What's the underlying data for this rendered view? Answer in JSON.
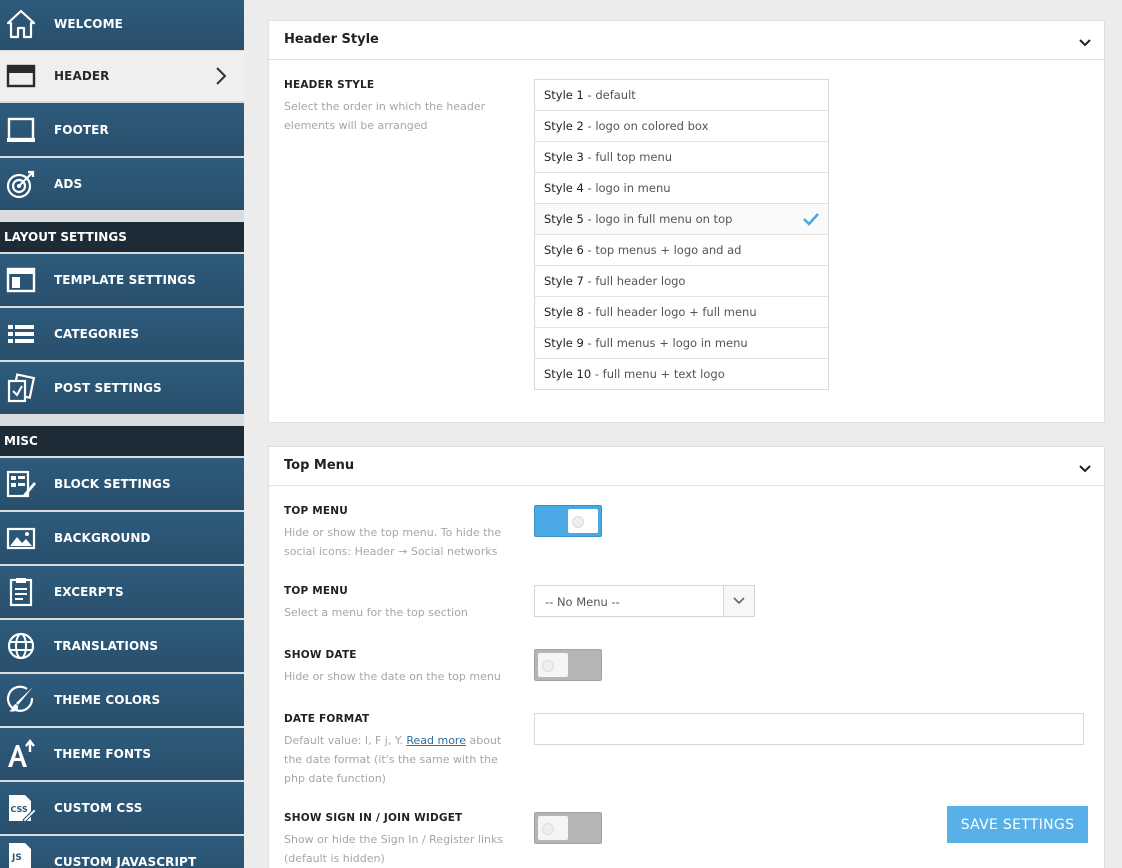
{
  "sidebar": {
    "items_top": [
      {
        "label": "WELCOME",
        "icon": "home-icon"
      },
      {
        "label": "HEADER",
        "icon": "header-icon",
        "active": true
      },
      {
        "label": "FOOTER",
        "icon": "footer-icon"
      },
      {
        "label": "ADS",
        "icon": "target-icon"
      }
    ],
    "section_layout": "LAYOUT SETTINGS",
    "items_layout": [
      {
        "label": "TEMPLATE SETTINGS",
        "icon": "template-icon"
      },
      {
        "label": "CATEGORIES",
        "icon": "list-icon"
      },
      {
        "label": "POST SETTINGS",
        "icon": "posts-icon"
      }
    ],
    "section_misc": "MISC",
    "items_misc": [
      {
        "label": "BLOCK SETTINGS",
        "icon": "block-settings-icon"
      },
      {
        "label": "BACKGROUND",
        "icon": "image-icon"
      },
      {
        "label": "EXCERPTS",
        "icon": "document-icon"
      },
      {
        "label": "TRANSLATIONS",
        "icon": "globe-icon"
      },
      {
        "label": "THEME COLORS",
        "icon": "brush-icon"
      },
      {
        "label": "THEME FONTS",
        "icon": "font-icon"
      },
      {
        "label": "CUSTOM CSS",
        "icon": "css-icon"
      },
      {
        "label": "CUSTOM JAVASCRIPT",
        "icon": "js-icon"
      }
    ]
  },
  "header_style_panel": {
    "title": "Header Style",
    "option_label": "HEADER STYLE",
    "option_desc": "Select the order in which the header elements will be arranged",
    "styles": [
      {
        "name": "Style 1",
        "desc": " - default"
      },
      {
        "name": "Style 2",
        "desc": " - logo on colored box"
      },
      {
        "name": "Style 3",
        "desc": " - full top menu"
      },
      {
        "name": "Style 4",
        "desc": " - logo in menu"
      },
      {
        "name": "Style 5",
        "desc": " - logo in full menu on top"
      },
      {
        "name": "Style 6",
        "desc": " - top menus + logo and ad"
      },
      {
        "name": "Style 7",
        "desc": " - full header logo"
      },
      {
        "name": "Style 8",
        "desc": " - full header logo + full menu"
      },
      {
        "name": "Style 9",
        "desc": " - full menus + logo in menu"
      },
      {
        "name": "Style 10",
        "desc": " - full menu + text logo"
      }
    ],
    "selected_index": 4
  },
  "top_menu_panel": {
    "title": "Top Menu",
    "top_menu_toggle": {
      "label": "TOP MENU",
      "desc": "Hide or show the top menu. To hide the social icons: Header → Social networks",
      "on": true
    },
    "top_menu_select": {
      "label": "TOP MENU",
      "desc": "Select a menu for the top section",
      "value": "-- No Menu --"
    },
    "show_date": {
      "label": "SHOW DATE",
      "desc": "Hide or show the date on the top menu",
      "on": false
    },
    "date_format": {
      "label": "DATE FORMAT",
      "desc_before": "Default value: l, F j, Y. ",
      "link": "Read more",
      "desc_after": " about the date format (it's the same with the php date function)",
      "value": ""
    },
    "sign_in": {
      "label": "SHOW SIGN IN / JOIN WIDGET",
      "desc": "Show or hide the Sign In / Register links (default is hidden)",
      "on": false
    }
  },
  "save_button": "SAVE SETTINGS",
  "colors": {
    "accent": "#4aa8e5",
    "sidebar": "#2b5574",
    "section": "#1d2b36"
  }
}
